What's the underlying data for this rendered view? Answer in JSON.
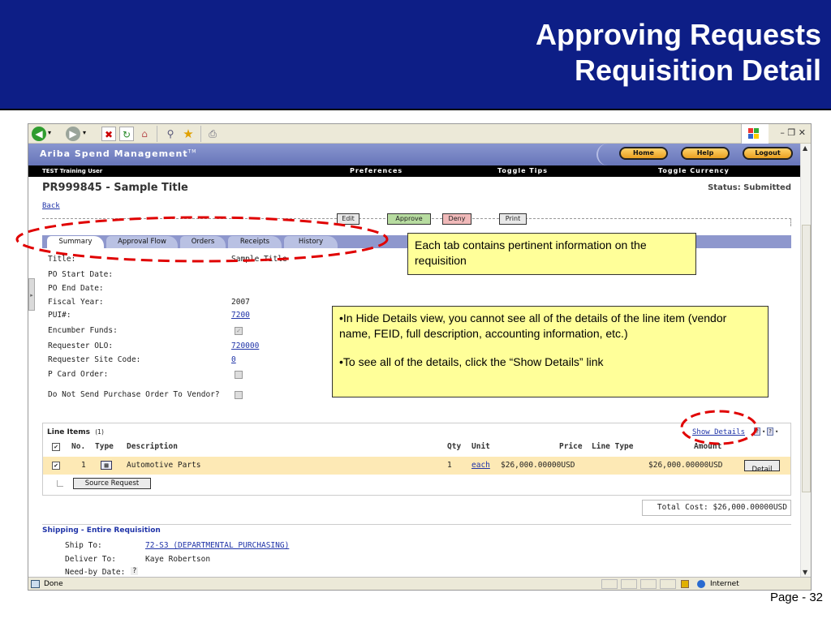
{
  "slide": {
    "title_line1": "Approving Requests",
    "title_line2": "Requisition Detail",
    "page_number": "Page - 32"
  },
  "browser": {
    "toolbar_icons": [
      "back-icon",
      "forward-icon",
      "stop-icon",
      "refresh-icon",
      "home-icon",
      "search-icon",
      "favorites-icon",
      "print-icon"
    ],
    "status_left": "Done",
    "status_zone": "Internet"
  },
  "app": {
    "name": "Ariba Spend Management",
    "name_tm": "TM",
    "nav_buttons": {
      "home": "Home",
      "help": "Help",
      "logout": "Logout"
    },
    "user": "TEST Training User",
    "menu": {
      "preferences": "Preferences",
      "toggle_tips": "Toggle Tips",
      "toggle_currency": "Toggle Currency"
    }
  },
  "requisition": {
    "title": "PR999845 - Sample Title",
    "status": "Status: Submitted",
    "back_label": "Back",
    "actions": {
      "edit": "Edit",
      "approve": "Approve",
      "deny": "Deny",
      "print": "Print"
    },
    "tabs": [
      "Summary",
      "Approval Flow",
      "Orders",
      "Receipts",
      "History"
    ],
    "fields": {
      "title_label": "Title:",
      "title_value": "Sample Title",
      "po_start_label": "PO Start Date:",
      "po_end_label": "PO End Date:",
      "fiscal_year_label": "Fiscal Year:",
      "fiscal_year_value": "2007",
      "pui_label": "PUI#:",
      "pui_value": "7200",
      "encumber_label": "Encumber Funds:",
      "requester_olo_label": "Requester OLO:",
      "requester_olo_value": "720000",
      "requester_site_label": "Requester Site Code:",
      "requester_site_value": "0",
      "pcard_label": "P Card Order:",
      "do_not_send_label": "Do Not Send Purchase Order To Vendor?"
    },
    "line_items": {
      "title": "Line Items",
      "count": "(1)",
      "show_details": "Show Details",
      "headers": {
        "no": "No.",
        "type": "Type",
        "description": "Description",
        "qty": "Qty",
        "unit": "Unit",
        "price": "Price",
        "line_type": "Line Type",
        "amount": "Amount"
      },
      "rows": [
        {
          "no": "1",
          "description": "Automotive Parts",
          "qty": "1",
          "unit": "each",
          "price": "$26,000.00000USD",
          "amount": "$26,000.00000USD",
          "detail": "Detail"
        }
      ],
      "source_request": "Source Request"
    },
    "total_cost": "Total Cost:  $26,000.00000USD",
    "shipping": {
      "title": "Shipping - Entire Requisition",
      "ship_to_label": "Ship To:",
      "ship_to_value": "72-S3 (DEPARTMENTAL PURCHASING)",
      "deliver_to_label": "Deliver To:",
      "deliver_to_value": "Kaye Robertson",
      "need_by_label": "Need-by Date:",
      "need_by_value": "?"
    }
  },
  "callouts": {
    "tabs": "Each tab contains pertinent information on the requisition",
    "details_1": "•In Hide Details view, you cannot see all of the details of the line item (vendor name, FEID, full description, accounting information, etc.)",
    "details_2": "•To see all of the details, click the “Show Details” link"
  },
  "colors": {
    "slide_header": "#0d1e86",
    "callout_bg": "#ffff99",
    "annotation_red": "#e00000",
    "line_item_row": "#fde9b5"
  }
}
